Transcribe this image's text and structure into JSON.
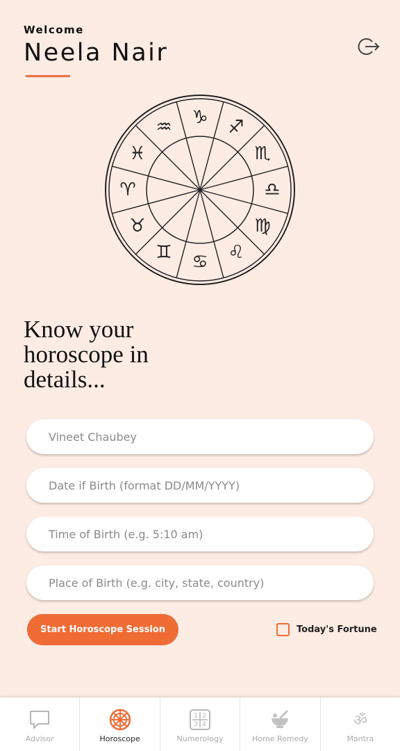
{
  "header": {
    "welcome": "Welcome",
    "username": "Neela Nair"
  },
  "icons": {
    "logout": "logout-icon",
    "wheel": "zodiac-wheel-icon"
  },
  "main": {
    "headline": "Know your horoscope in details..."
  },
  "form": {
    "name_placeholder": "Vineet Chaubey",
    "dob_placeholder": "Date if Birth (format DD/MM/YYYY)",
    "tob_placeholder": "Time of Birth (e.g. 5:10 am)",
    "pob_placeholder": "Place of Birth (e.g. city, state, country)",
    "start_button": "Start Horoscope Session",
    "fortune_label": "Today's Fortune",
    "fortune_checked": false
  },
  "nav": {
    "items": [
      {
        "label": "Advisor",
        "icon": "chat-bubble-icon",
        "active": false
      },
      {
        "label": "Horoscope",
        "icon": "dharma-wheel-icon",
        "active": true
      },
      {
        "label": "Numerology",
        "icon": "number-grid-icon",
        "active": false
      },
      {
        "label": "Home Remedy",
        "icon": "mortar-pestle-icon",
        "active": false
      },
      {
        "label": "Mantra",
        "icon": "om-icon",
        "active": false
      }
    ]
  },
  "colors": {
    "accent": "#ef6c35",
    "background": "#fdece4",
    "inactive": "#a9a9a9"
  }
}
